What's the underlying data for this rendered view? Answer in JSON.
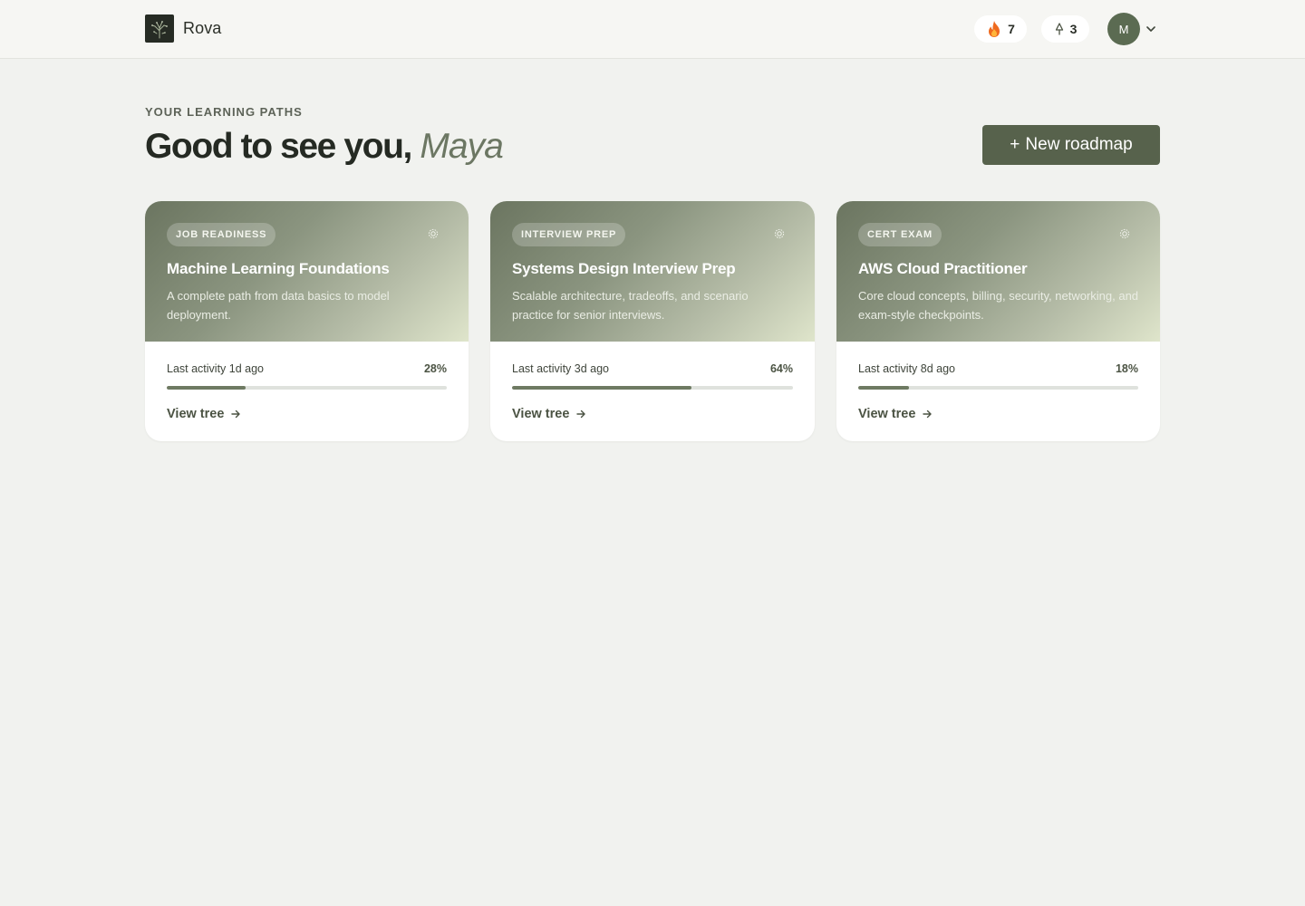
{
  "app": {
    "name": "Rova",
    "logo_icon": "tree-logo-icon"
  },
  "header": {
    "streak": {
      "icon": "fire-icon",
      "value": "7"
    },
    "trees": {
      "icon": "tree-icon",
      "value": "3"
    },
    "avatar_initial": "M",
    "avatar_menu_icon": "chevron-down-icon"
  },
  "hero": {
    "eyebrow": "YOUR LEARNING PATHS",
    "greeting": "Good to see you,",
    "name": "Maya",
    "new_button": {
      "icon": "+",
      "label": "New roadmap"
    }
  },
  "cards": [
    {
      "tag": "JOB READINESS",
      "title": "Machine Learning Foundations",
      "description": "A complete path from data basics to model deployment.",
      "activity": "Last activity 1d ago",
      "progress_label": "28%",
      "progress": 28,
      "link": "View tree"
    },
    {
      "tag": "INTERVIEW PREP",
      "title": "Systems Design Interview Prep",
      "description": "Scalable architecture, tradeoffs, and scenario practice for senior interviews.",
      "activity": "Last activity 3d ago",
      "progress_label": "64%",
      "progress": 64,
      "link": "View tree"
    },
    {
      "tag": "CERT EXAM",
      "title": "AWS Cloud Practitioner",
      "description": "Core cloud concepts, billing, security, networking, and exam-style checkpoints.",
      "activity": "Last activity 8d ago",
      "progress_label": "18%",
      "progress": 18,
      "link": "View tree"
    }
  ],
  "colors": {
    "accent": "#57624c",
    "background": "#f1f2ef",
    "progress_fill": "#6e7a62"
  }
}
